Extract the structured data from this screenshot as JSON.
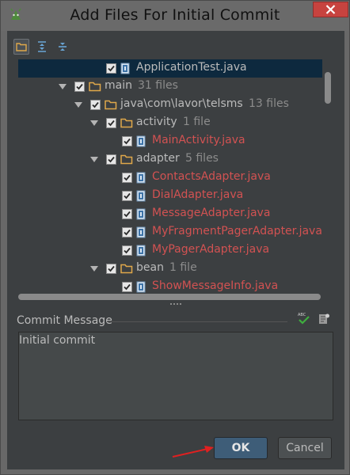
{
  "window": {
    "title": "Add Files For Initial Commit",
    "app_icon": "android-icon",
    "close_icon": "close-icon"
  },
  "toolbar": {
    "buttons": [
      {
        "icon": "group-by-directory-icon",
        "active": true
      },
      {
        "icon": "expand-all-icon",
        "active": false
      },
      {
        "icon": "collapse-all-icon",
        "active": false
      }
    ]
  },
  "tree": {
    "rows": [
      {
        "name": "ApplicationTest.java",
        "count": "",
        "type": "java-file",
        "modified": false,
        "checked": true,
        "selected": true,
        "expanded": false,
        "depth": 4
      },
      {
        "name": "main",
        "count": "31 files",
        "type": "folder",
        "modified": false,
        "checked": true,
        "selected": false,
        "expanded": true,
        "depth": 2
      },
      {
        "name": "java\\com\\lavor\\telsms",
        "count": "13 files",
        "type": "folder",
        "modified": false,
        "checked": true,
        "selected": false,
        "expanded": true,
        "depth": 3
      },
      {
        "name": "activity",
        "count": "1 file",
        "type": "folder",
        "modified": false,
        "checked": true,
        "selected": false,
        "expanded": true,
        "depth": 4
      },
      {
        "name": "MainActivity.java",
        "count": "",
        "type": "java-file",
        "modified": true,
        "checked": true,
        "selected": false,
        "expanded": false,
        "depth": 5
      },
      {
        "name": "adapter",
        "count": "5 files",
        "type": "folder",
        "modified": false,
        "checked": true,
        "selected": false,
        "expanded": true,
        "depth": 4
      },
      {
        "name": "ContactsAdapter.java",
        "count": "",
        "type": "java-file",
        "modified": true,
        "checked": true,
        "selected": false,
        "expanded": false,
        "depth": 5
      },
      {
        "name": "DialAdapter.java",
        "count": "",
        "type": "java-file",
        "modified": true,
        "checked": true,
        "selected": false,
        "expanded": false,
        "depth": 5
      },
      {
        "name": "MessageAdapter.java",
        "count": "",
        "type": "java-file",
        "modified": true,
        "checked": true,
        "selected": false,
        "expanded": false,
        "depth": 5
      },
      {
        "name": "MyFragmentPagerAdapter.java",
        "count": "",
        "type": "java-file",
        "modified": true,
        "checked": true,
        "selected": false,
        "expanded": false,
        "depth": 5
      },
      {
        "name": "MyPagerAdapter.java",
        "count": "",
        "type": "java-file",
        "modified": true,
        "checked": true,
        "selected": false,
        "expanded": false,
        "depth": 5
      },
      {
        "name": "bean",
        "count": "1 file",
        "type": "folder",
        "modified": false,
        "checked": true,
        "selected": false,
        "expanded": true,
        "depth": 4
      },
      {
        "name": "ShowMessageInfo.java",
        "count": "",
        "type": "java-file",
        "modified": true,
        "checked": true,
        "selected": false,
        "expanded": false,
        "depth": 5
      }
    ]
  },
  "commit": {
    "label": "Commit Message",
    "message": "Initial commit",
    "spellcheck_icon": "spellcheck-abc-icon",
    "history_icon": "commit-message-history-icon"
  },
  "buttons": {
    "ok": "OK",
    "cancel": "Cancel"
  },
  "colors": {
    "modified_file": "#d25252",
    "selection": "#0d293e",
    "default_button": "#3e5d78",
    "annotation_arrow": "#e02020"
  }
}
